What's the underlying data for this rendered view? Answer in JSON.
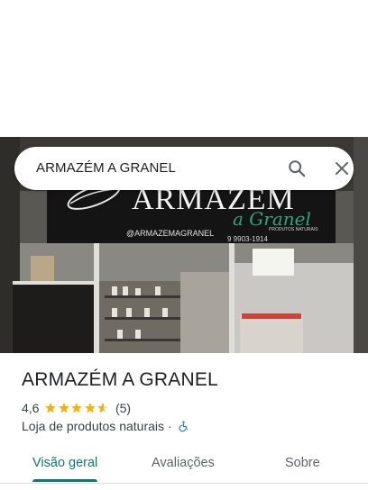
{
  "search": {
    "query": "ARMAZÉM A GRANEL"
  },
  "photo": {
    "sign_main": "ARMAZÉM",
    "sign_sub": "a Granel",
    "sign_tag": "PRODUTOS NATURAIS",
    "sign_instagram": "@ARMAZEMAGRANEL",
    "sign_phone": "9 9903-1914"
  },
  "place": {
    "name": "ARMAZÉM A GRANEL",
    "rating": "4,6",
    "stars_value": 4.6,
    "review_count": "(5)",
    "category": "Loja de produtos naturais",
    "separator": "·"
  },
  "tabs": [
    {
      "label": "Visão geral",
      "active": true
    },
    {
      "label": "Avaliações",
      "active": false
    },
    {
      "label": "Sobre",
      "active": false
    }
  ],
  "colors": {
    "accent": "#0b7a6e",
    "star": "#f4b400",
    "access_icon": "#1a73e8"
  }
}
